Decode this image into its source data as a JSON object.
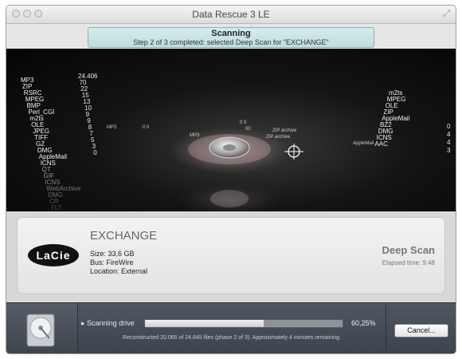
{
  "window": {
    "title": "Data Rescue 3 LE"
  },
  "status": {
    "title": "Scanning",
    "step": "Step 2 of 3 completed: selected Deep Scan for \"EXCHANGE\""
  },
  "visualization": {
    "left_file_types": [
      "MP3",
      "ZIP",
      "RSRC",
      "MPEG",
      "BMP",
      "Perl_CGI",
      "m2ts",
      "OLE",
      "JPEG",
      "TIFF",
      "GZ",
      "DMG",
      "AppleMail",
      "ICNS",
      "QT",
      "GIF",
      "ICNS",
      "WebArchive",
      "DMG",
      "CR",
      "FLT",
      "PSD",
      "AIF"
    ],
    "left_counts": [
      "24.406",
      "70",
      "22",
      "15",
      "13",
      "10",
      "9",
      "9",
      "8",
      "7",
      "5",
      "3",
      "0"
    ],
    "right_file_types": [
      "m2ts",
      "MPEG",
      "OLE",
      "ZIP",
      "AppleMail",
      "BZ2",
      "DMG",
      "ICNS",
      "AAC"
    ],
    "right_counts": [
      "0",
      "4",
      "4",
      "3"
    ],
    "floating_labels": [
      "MP3",
      "MP3",
      "ZIP archive",
      "ZIP archive",
      "AppleMail",
      "0 0",
      "00",
      "0 0"
    ]
  },
  "drive": {
    "name": "EXCHANGE",
    "size": "Size: 33,6 GB",
    "bus": "Bus: FireWire",
    "location": "Location: External",
    "brand": "LaCie"
  },
  "scan": {
    "mode": "Deep Scan",
    "elapsed": "Elapsed time: 9:48",
    "label": "Scanning drive",
    "progress": 0.6025,
    "percent_text": "60,25%",
    "detail": "Reconstructed 20.065 of 24.845 files (phase 2 of 3). Approximately 4 minutes remaining."
  },
  "buttons": {
    "cancel": "Cancel..."
  },
  "icons": {
    "drive": "hard-drive-icon",
    "disclosure": "disclosure-triangle-icon",
    "resize": "resize-icon"
  }
}
